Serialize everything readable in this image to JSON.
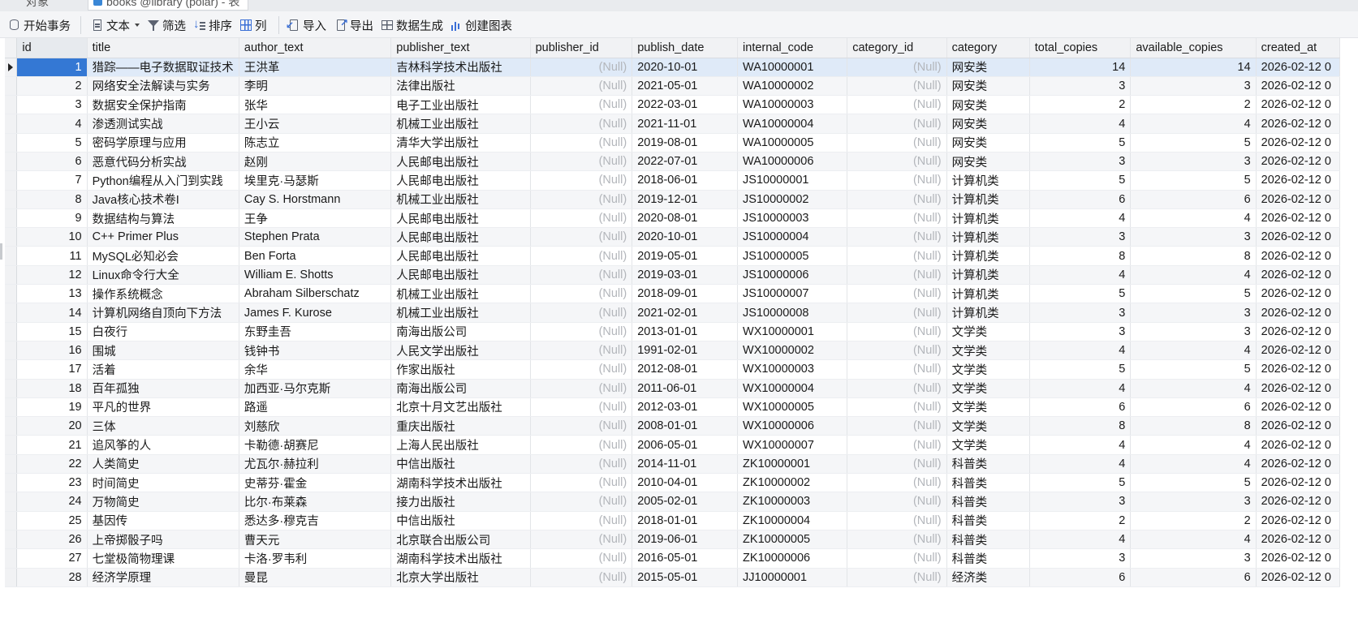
{
  "tabs": [
    {
      "label": "对象"
    },
    {
      "label": "books @library (polar) - 表"
    }
  ],
  "toolbar": {
    "begin_transaction": "开始事务",
    "text": "文本",
    "filter": "筛选",
    "sort": "排序",
    "columns": "列",
    "import": "导入",
    "export": "导出",
    "data_generation": "数据生成",
    "create_chart": "创建图表"
  },
  "grid": {
    "columns": [
      "id",
      "title",
      "author_text",
      "publisher_text",
      "publisher_id",
      "publish_date",
      "internal_code",
      "category_id",
      "category",
      "total_copies",
      "available_copies",
      "created_at"
    ],
    "null_label": "(Null)",
    "rows": [
      [
        "1",
        "猎踪——电子数据取证技术",
        "王洪革",
        "吉林科学技术出版社",
        "(Null)",
        "2020-10-01",
        "WA10000001",
        "(Null)",
        "网安类",
        "14",
        "14",
        "2026-02-12 0"
      ],
      [
        "2",
        "网络安全法解读与实务",
        "李明",
        "法律出版社",
        "(Null)",
        "2021-05-01",
        "WA10000002",
        "(Null)",
        "网安类",
        "3",
        "3",
        "2026-02-12 0"
      ],
      [
        "3",
        "数据安全保护指南",
        "张华",
        "电子工业出版社",
        "(Null)",
        "2022-03-01",
        "WA10000003",
        "(Null)",
        "网安类",
        "2",
        "2",
        "2026-02-12 0"
      ],
      [
        "4",
        "渗透测试实战",
        "王小云",
        "机械工业出版社",
        "(Null)",
        "2021-11-01",
        "WA10000004",
        "(Null)",
        "网安类",
        "4",
        "4",
        "2026-02-12 0"
      ],
      [
        "5",
        "密码学原理与应用",
        "陈志立",
        "清华大学出版社",
        "(Null)",
        "2019-08-01",
        "WA10000005",
        "(Null)",
        "网安类",
        "5",
        "5",
        "2026-02-12 0"
      ],
      [
        "6",
        "恶意代码分析实战",
        "赵刚",
        "人民邮电出版社",
        "(Null)",
        "2022-07-01",
        "WA10000006",
        "(Null)",
        "网安类",
        "3",
        "3",
        "2026-02-12 0"
      ],
      [
        "7",
        "Python编程从入门到实践",
        "埃里克·马瑟斯",
        "人民邮电出版社",
        "(Null)",
        "2018-06-01",
        "JS10000001",
        "(Null)",
        "计算机类",
        "5",
        "5",
        "2026-02-12 0"
      ],
      [
        "8",
        "Java核心技术卷I",
        "Cay S. Horstmann",
        "机械工业出版社",
        "(Null)",
        "2019-12-01",
        "JS10000002",
        "(Null)",
        "计算机类",
        "6",
        "6",
        "2026-02-12 0"
      ],
      [
        "9",
        "数据结构与算法",
        "王争",
        "人民邮电出版社",
        "(Null)",
        "2020-08-01",
        "JS10000003",
        "(Null)",
        "计算机类",
        "4",
        "4",
        "2026-02-12 0"
      ],
      [
        "10",
        "C++ Primer Plus",
        "Stephen Prata",
        "人民邮电出版社",
        "(Null)",
        "2020-10-01",
        "JS10000004",
        "(Null)",
        "计算机类",
        "3",
        "3",
        "2026-02-12 0"
      ],
      [
        "11",
        "MySQL必知必会",
        "Ben Forta",
        "人民邮电出版社",
        "(Null)",
        "2019-05-01",
        "JS10000005",
        "(Null)",
        "计算机类",
        "8",
        "8",
        "2026-02-12 0"
      ],
      [
        "12",
        "Linux命令行大全",
        "William E. Shotts",
        "人民邮电出版社",
        "(Null)",
        "2019-03-01",
        "JS10000006",
        "(Null)",
        "计算机类",
        "4",
        "4",
        "2026-02-12 0"
      ],
      [
        "13",
        "操作系统概念",
        "Abraham Silberschatz",
        "机械工业出版社",
        "(Null)",
        "2018-09-01",
        "JS10000007",
        "(Null)",
        "计算机类",
        "5",
        "5",
        "2026-02-12 0"
      ],
      [
        "14",
        "计算机网络自顶向下方法",
        "James F. Kurose",
        "机械工业出版社",
        "(Null)",
        "2021-02-01",
        "JS10000008",
        "(Null)",
        "计算机类",
        "3",
        "3",
        "2026-02-12 0"
      ],
      [
        "15",
        "白夜行",
        "东野圭吾",
        "南海出版公司",
        "(Null)",
        "2013-01-01",
        "WX10000001",
        "(Null)",
        "文学类",
        "3",
        "3",
        "2026-02-12 0"
      ],
      [
        "16",
        "围城",
        "钱钟书",
        "人民文学出版社",
        "(Null)",
        "1991-02-01",
        "WX10000002",
        "(Null)",
        "文学类",
        "4",
        "4",
        "2026-02-12 0"
      ],
      [
        "17",
        "活着",
        "余华",
        "作家出版社",
        "(Null)",
        "2012-08-01",
        "WX10000003",
        "(Null)",
        "文学类",
        "5",
        "5",
        "2026-02-12 0"
      ],
      [
        "18",
        "百年孤独",
        "加西亚·马尔克斯",
        "南海出版公司",
        "(Null)",
        "2011-06-01",
        "WX10000004",
        "(Null)",
        "文学类",
        "4",
        "4",
        "2026-02-12 0"
      ],
      [
        "19",
        "平凡的世界",
        "路遥",
        "北京十月文艺出版社",
        "(Null)",
        "2012-03-01",
        "WX10000005",
        "(Null)",
        "文学类",
        "6",
        "6",
        "2026-02-12 0"
      ],
      [
        "20",
        "三体",
        "刘慈欣",
        "重庆出版社",
        "(Null)",
        "2008-01-01",
        "WX10000006",
        "(Null)",
        "文学类",
        "8",
        "8",
        "2026-02-12 0"
      ],
      [
        "21",
        "追风筝的人",
        "卡勒德·胡赛尼",
        "上海人民出版社",
        "(Null)",
        "2006-05-01",
        "WX10000007",
        "(Null)",
        "文学类",
        "4",
        "4",
        "2026-02-12 0"
      ],
      [
        "22",
        "人类简史",
        "尤瓦尔·赫拉利",
        "中信出版社",
        "(Null)",
        "2014-11-01",
        "ZK10000001",
        "(Null)",
        "科普类",
        "4",
        "4",
        "2026-02-12 0"
      ],
      [
        "23",
        "时间简史",
        "史蒂芬·霍金",
        "湖南科学技术出版社",
        "(Null)",
        "2010-04-01",
        "ZK10000002",
        "(Null)",
        "科普类",
        "5",
        "5",
        "2026-02-12 0"
      ],
      [
        "24",
        "万物简史",
        "比尔·布莱森",
        "接力出版社",
        "(Null)",
        "2005-02-01",
        "ZK10000003",
        "(Null)",
        "科普类",
        "3",
        "3",
        "2026-02-12 0"
      ],
      [
        "25",
        "基因传",
        "悉达多·穆克吉",
        "中信出版社",
        "(Null)",
        "2018-01-01",
        "ZK10000004",
        "(Null)",
        "科普类",
        "2",
        "2",
        "2026-02-12 0"
      ],
      [
        "26",
        "上帝掷骰子吗",
        "曹天元",
        "北京联合出版公司",
        "(Null)",
        "2019-06-01",
        "ZK10000005",
        "(Null)",
        "科普类",
        "4",
        "4",
        "2026-02-12 0"
      ],
      [
        "27",
        "七堂极简物理课",
        "卡洛·罗韦利",
        "湖南科学技术出版社",
        "(Null)",
        "2016-05-01",
        "ZK10000006",
        "(Null)",
        "科普类",
        "3",
        "3",
        "2026-02-12 0"
      ],
      [
        "28",
        "经济学原理",
        "曼昆",
        "北京大学出版社",
        "(Null)",
        "2015-05-01",
        "JJ10000001",
        "(Null)",
        "经济类",
        "6",
        "6",
        "2026-02-12 0"
      ]
    ]
  },
  "colors": {
    "selected_row": "#dfeaf8",
    "selected_cell": "#3478d4",
    "null_text": "#b3b6bb",
    "header_bg": "#f1f2f4"
  },
  "icons": {
    "begin_transaction": "database-icon",
    "text": "document-icon",
    "filter": "filter-icon",
    "sort": "sort-icon",
    "columns": "grid-icon",
    "import": "import-icon",
    "export": "export-icon",
    "data_generation": "table-generate-icon",
    "create_chart": "bar-chart-icon"
  }
}
